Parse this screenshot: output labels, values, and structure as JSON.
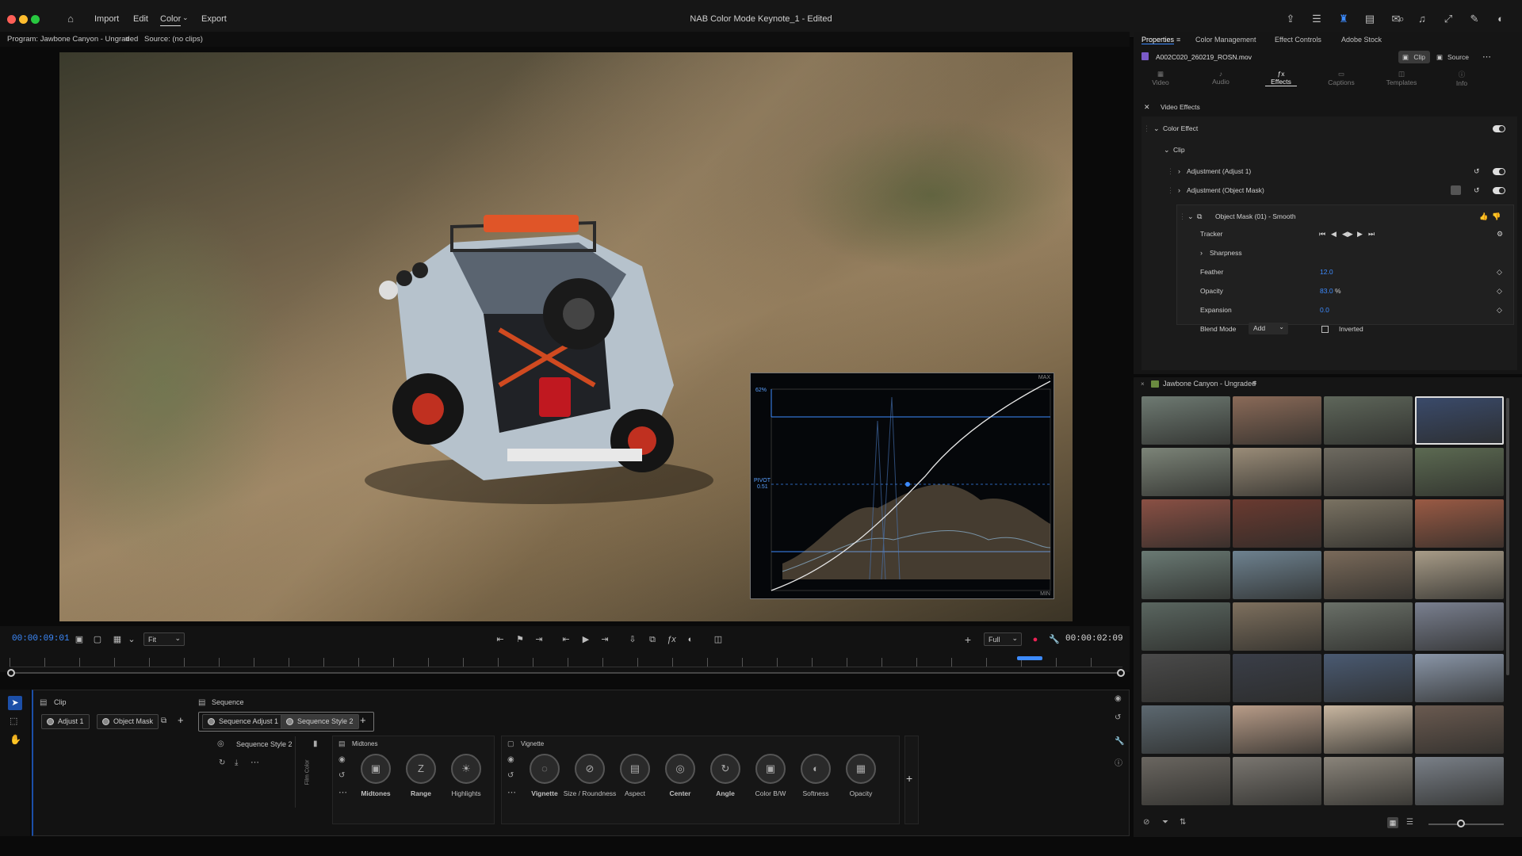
{
  "menubar": {
    "items": [
      "Import",
      "Edit",
      "Color",
      "Export"
    ],
    "title": "NAB Color Mode Keynote_1 - Edited"
  },
  "monitor": {
    "program_label": "Program: Jawbone Canyon - Ungraded",
    "source_label": "Source: (no clips)"
  },
  "scope": {
    "pivot": "PIVOT",
    "pivot_val": "0.51",
    "top_val": "62%",
    "max": "MAX",
    "min": "MIN"
  },
  "transport": {
    "timecode_left": "00:00:09:01",
    "fit": "Fit",
    "quality": "Full",
    "timecode_right": "00:00:02:09"
  },
  "bottom": {
    "clip_label": "Clip",
    "sequence_label": "Sequence",
    "clip_chips": [
      "Adjust 1",
      "Object Mask"
    ],
    "seq_chips": [
      "Sequence Adjust 1",
      "Sequence Style 2"
    ],
    "seq_style": "Sequence Style 2",
    "film_color": "Film Color",
    "midtones_title": "Midtones",
    "midtones_knobs": [
      "Midtones",
      "Range",
      "Highlights"
    ],
    "vignette_title": "Vignette",
    "vignette_knobs": [
      "Vignette",
      "Size / Roundness",
      "Aspect",
      "Center",
      "Angle",
      "Color B/W",
      "Softness",
      "Opacity"
    ]
  },
  "properties": {
    "tabs": [
      "Properties",
      "Color Management",
      "Effect Controls",
      "Adobe Stock"
    ],
    "filename": "A002C020_260219_ROSN.mov",
    "clip_btn": "Clip",
    "source_btn": "Source",
    "subtabs": [
      "Video",
      "Audio",
      "Effects",
      "Captions",
      "Templates",
      "Info"
    ],
    "video_effects": "Video Effects",
    "color_effect": "Color Effect",
    "clip": "Clip",
    "adj1": "Adjustment (Adjust 1)",
    "adj_mask": "Adjustment (Object Mask)",
    "object_mask": "Object Mask (01) - Smooth",
    "tracker": "Tracker",
    "sharpness": "Sharpness",
    "feather_label": "Feather",
    "feather_val": "12.0",
    "opacity_label": "Opacity",
    "opacity_val": "83.0",
    "opacity_unit": "%",
    "expansion_label": "Expansion",
    "expansion_val": "0.0",
    "blend_label": "Blend Mode",
    "blend_val": "Add",
    "inverted": "Inverted"
  },
  "bin": {
    "title": "Jawbone Canyon - Ungraded",
    "thumb_colors": [
      [
        "#6e7a72",
        "#8a6a58",
        "#5e665a",
        "#3a4a6a"
      ],
      [
        "#7c8478",
        "#9a8c78",
        "#6e6a60",
        "#5c6a52"
      ],
      [
        "#8a5044",
        "#6a3a30",
        "#7a7262",
        "#9a5a44"
      ],
      [
        "#6a7a74",
        "#6e8290",
        "#7a6a5a",
        "#a89c88"
      ],
      [
        "#5a6660",
        "#7e705e",
        "#6a7068",
        "#7a8090"
      ],
      [
        "#4a4a4a",
        "#3a3e48",
        "#4a5a72",
        "#8a96a8"
      ],
      [
        "#5c6870",
        "#b89c88",
        "#c8b6a0",
        "#6a5a50"
      ],
      [
        "#6a6660",
        "#7a7670",
        "#8a847a",
        "#7a8088"
      ]
    ]
  },
  "colors": {
    "accent": "#3d8bff",
    "panel": "#151515"
  }
}
